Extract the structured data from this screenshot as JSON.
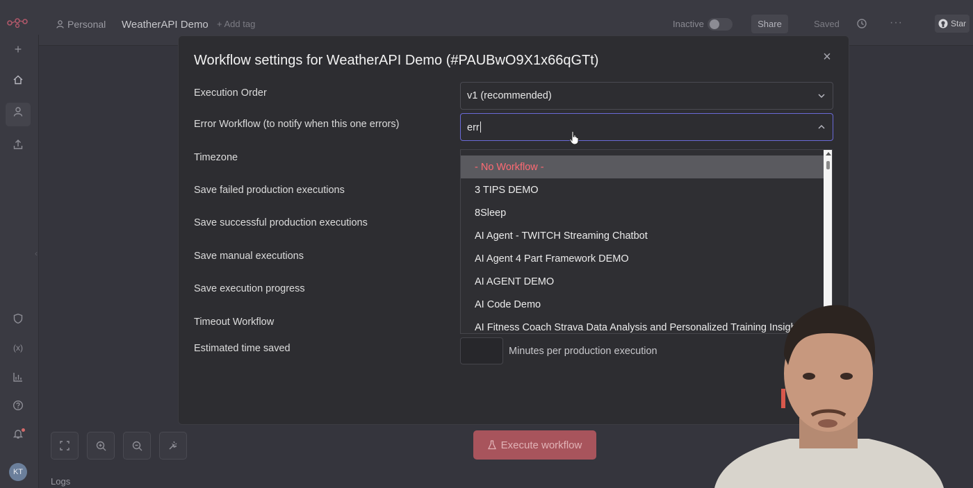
{
  "topbar": {
    "workspace": "Personal",
    "workflow_name": "WeatherAPI Demo",
    "add_tag": "+ Add tag",
    "status_label": "Inactive",
    "share_label": "Share",
    "saved_label": "Saved",
    "star_label": "Star"
  },
  "sidebar": {
    "avatar_initials": "KT",
    "icons": [
      "add-icon",
      "home-icon",
      "user-icon",
      "upload-icon",
      "shield-icon",
      "variables-icon",
      "chart-icon",
      "help-icon",
      "bell-icon"
    ]
  },
  "modal": {
    "title": "Workflow settings for WeatherAPI Demo (#PAUBwO9X1x66qGTt)",
    "fields": [
      {
        "label": "Execution Order"
      },
      {
        "label": "Error Workflow (to notify when this one errors)"
      },
      {
        "label": "Timezone"
      },
      {
        "label": "Save failed production executions"
      },
      {
        "label": "Save successful production executions"
      },
      {
        "label": "Save manual executions"
      },
      {
        "label": "Save execution progress"
      },
      {
        "label": "Timeout Workflow"
      },
      {
        "label": "Estimated time saved"
      }
    ],
    "execution_order_value": "v1 (recommended)",
    "error_workflow_search": "err",
    "minutes_label": "Minutes per production execution",
    "dropdown_options": [
      "- No Workflow -",
      "3 TIPS DEMO",
      "8Sleep",
      "AI Agent - TWITCH Streaming Chatbot",
      "AI Agent 4 Part Framework DEMO",
      "AI AGENT DEMO",
      "AI Code Demo",
      "AI Fitness Coach Strava Data Analysis and Personalized Training Insights"
    ]
  },
  "canvas": {
    "execute_label": "Execute workflow",
    "logs_label": "Logs"
  },
  "colors": {
    "accent": "#ff6d5a",
    "selected_option_text": "#ff6a73",
    "modal_bg": "#2d2d31"
  }
}
